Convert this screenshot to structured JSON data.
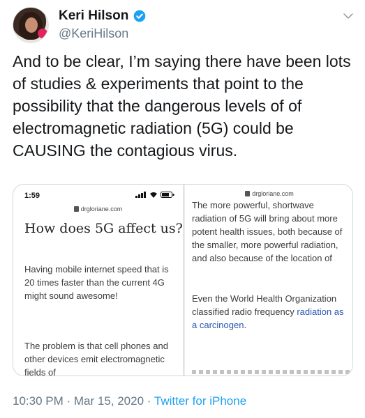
{
  "user": {
    "name": "Keri Hilson",
    "handle": "@KeriHilson"
  },
  "tweet": {
    "text": "And to be clear, I’m saying there have been lots of studies & experiments that point to the possibility that the dangerous levels of of electromagnetic radiation (5G) could be CAUSING the contagious virus."
  },
  "media": {
    "left": {
      "time": "1:59",
      "url": "drgloriane.com",
      "title": "How does 5G affect us?",
      "para1": "Having mobile internet speed that is 20 times faster than the current 4G might sound awesome!",
      "para2": "The problem is that cell phones and other devices emit electromagnetic fields of"
    },
    "right": {
      "url": "drgloriane.com",
      "para1": "The more powerful, shortwave radiation of 5G will bring about more potent health issues, both because of the smaller, more powerful radiation, and also because of the location of",
      "para2_start": "Even the World Health Organization classified radio frequency ",
      "para2_link": "radiation as a carcinogen",
      "para2_end": "."
    }
  },
  "footer": {
    "time": "10:30 PM",
    "separator1": " · ",
    "date": "Mar 15, 2020",
    "separator2": " · ",
    "source": "Twitter for iPhone"
  },
  "colors": {
    "verified": "#1da1f2",
    "link": "#1da1f2",
    "muted": "#657786"
  }
}
